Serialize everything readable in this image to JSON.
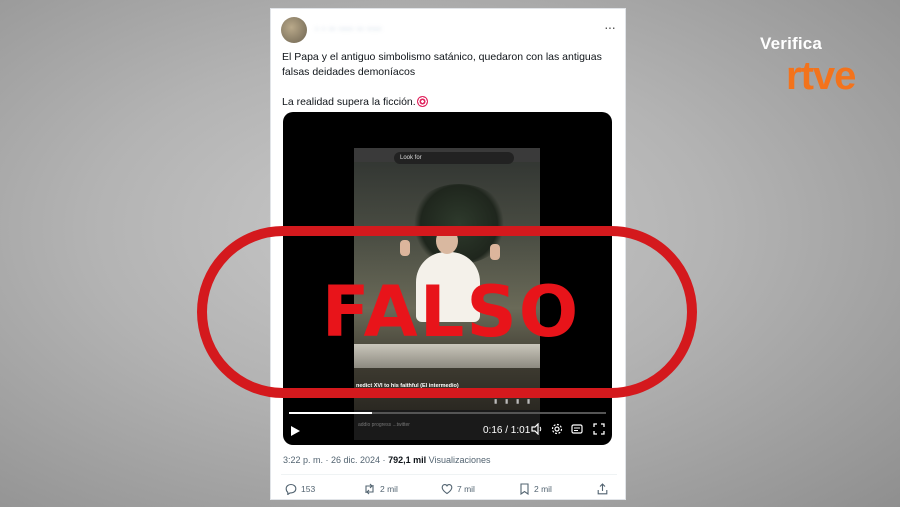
{
  "tweet": {
    "handle": "· · ·· ···· ·· ····",
    "more_label": "···",
    "text_line1": "El Papa y el antiguo simbolismo satánico,  quedaron con las antiguas falsas deidades demoníacos",
    "text_line2": "La realidad supera la ficción.",
    "timestamp": "3:22 p. m. · 26 dic. 2024 ·",
    "views_count": "792,1 mil",
    "views_label": "Visualizaciones",
    "replies": "153",
    "reposts": "2 mil",
    "likes": "7 mil",
    "bookmarks": "2 mil"
  },
  "video": {
    "search_placeholder": "Look for",
    "caption": "nedict XVI to his faithful (El intermedio)",
    "bottom_text": "addio progress ...twitter",
    "time": "0:16 / 1:01",
    "progress": 0.262
  },
  "stamp": {
    "label": "FALSO",
    "color": "#d4191d"
  },
  "logo": {
    "line1": "Verifica",
    "line2": "rtve",
    "accent": "#f3731c"
  }
}
